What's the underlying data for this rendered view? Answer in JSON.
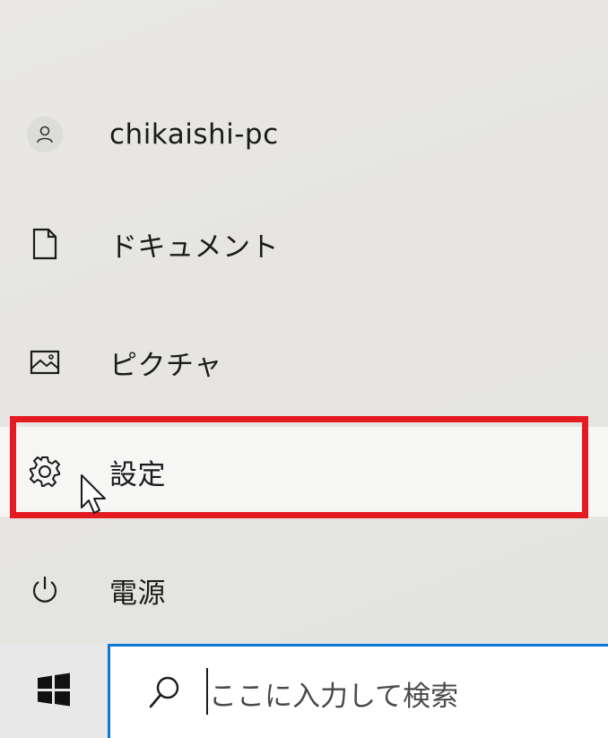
{
  "start_menu": {
    "items": [
      {
        "id": "user",
        "label": "chikaishi-pc",
        "icon": "user-icon"
      },
      {
        "id": "documents",
        "label": "ドキュメント",
        "icon": "document-icon"
      },
      {
        "id": "pictures",
        "label": "ピクチャ",
        "icon": "picture-icon"
      },
      {
        "id": "settings",
        "label": "設定",
        "icon": "gear-icon",
        "highlighted": true
      },
      {
        "id": "power",
        "label": "電源",
        "icon": "power-icon"
      }
    ]
  },
  "taskbar": {
    "start_icon": "windows-logo-icon",
    "search": {
      "icon": "search-icon",
      "placeholder": "ここに入力して検索"
    }
  },
  "colors": {
    "highlight_border": "#e51b23",
    "search_accent": "#0a78d7"
  }
}
